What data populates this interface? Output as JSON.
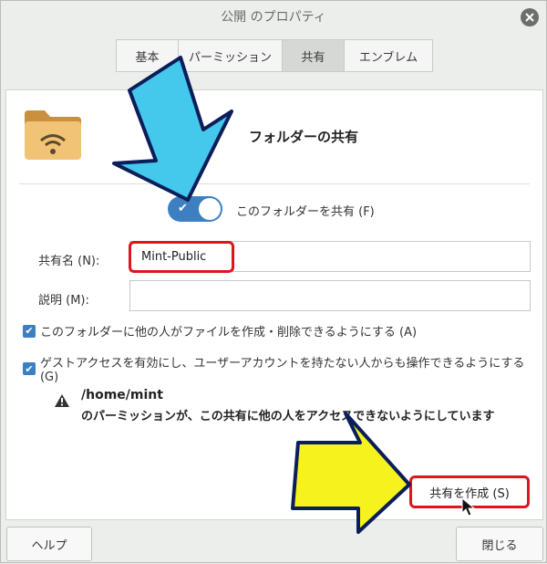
{
  "window": {
    "title": "公開 のプロパティ"
  },
  "tabs": [
    {
      "label": "基本",
      "active": false
    },
    {
      "label": "パーミッション",
      "active": false
    },
    {
      "label": "共有",
      "active": true
    },
    {
      "label": "エンブレム",
      "active": false
    }
  ],
  "share": {
    "heading": "フォルダーの共有",
    "toggle_label": "このフォルダーを共有 (F)",
    "toggle_on": true,
    "name_label": "共有名 (N):",
    "name_value": "Mint-Public",
    "comment_label": "説明 (M):",
    "comment_value": "",
    "checkbox_write": "このフォルダーに他の人がファイルを作成・削除できるようにする (A)",
    "checkbox_guest": "ゲストアクセスを有効にし、ユーザーアカウントを持たない人からも操作できるようにする (G)",
    "warning_path": "/home/mint",
    "warning_text": "のパーミッションが、この共有に他の人をアクセスできないようにしています",
    "create_button": "共有を作成 (S)"
  },
  "footer": {
    "help_button": "ヘルプ",
    "close_button": "閉じる"
  },
  "colors": {
    "accent": "#3d7fc1",
    "highlight": "#e0141e",
    "arrow_cyan": "#44c8ec",
    "arrow_yellow": "#f6f21e"
  }
}
